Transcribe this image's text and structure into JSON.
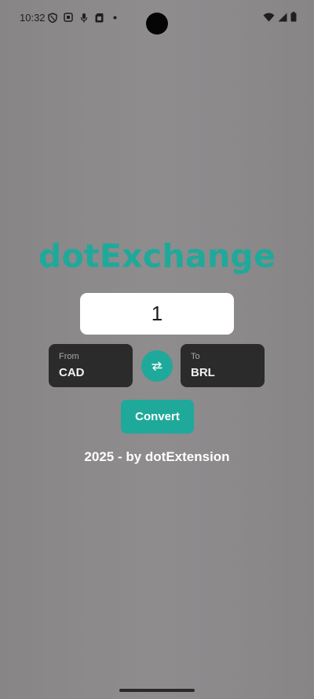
{
  "status_bar": {
    "time": "10:32",
    "left_icons": [
      "shield-icon",
      "screen-record-icon",
      "microphone-icon",
      "sim-card-icon",
      "dot-icon"
    ],
    "right_icons": [
      "wifi-icon",
      "cell-signal-icon",
      "battery-icon"
    ]
  },
  "app": {
    "title": "dotExchange",
    "amount_value": "1",
    "from": {
      "caption": "From",
      "currency": "CAD"
    },
    "to": {
      "caption": "To",
      "currency": "BRL"
    },
    "swap_icon": "swap-arrows-icon",
    "convert_label": "Convert",
    "footer": "2025 - by dotExtension"
  },
  "colors": {
    "accent": "#1fa99a",
    "overlay_background": "#8a8889",
    "currency_box": "#2c2b2c"
  }
}
